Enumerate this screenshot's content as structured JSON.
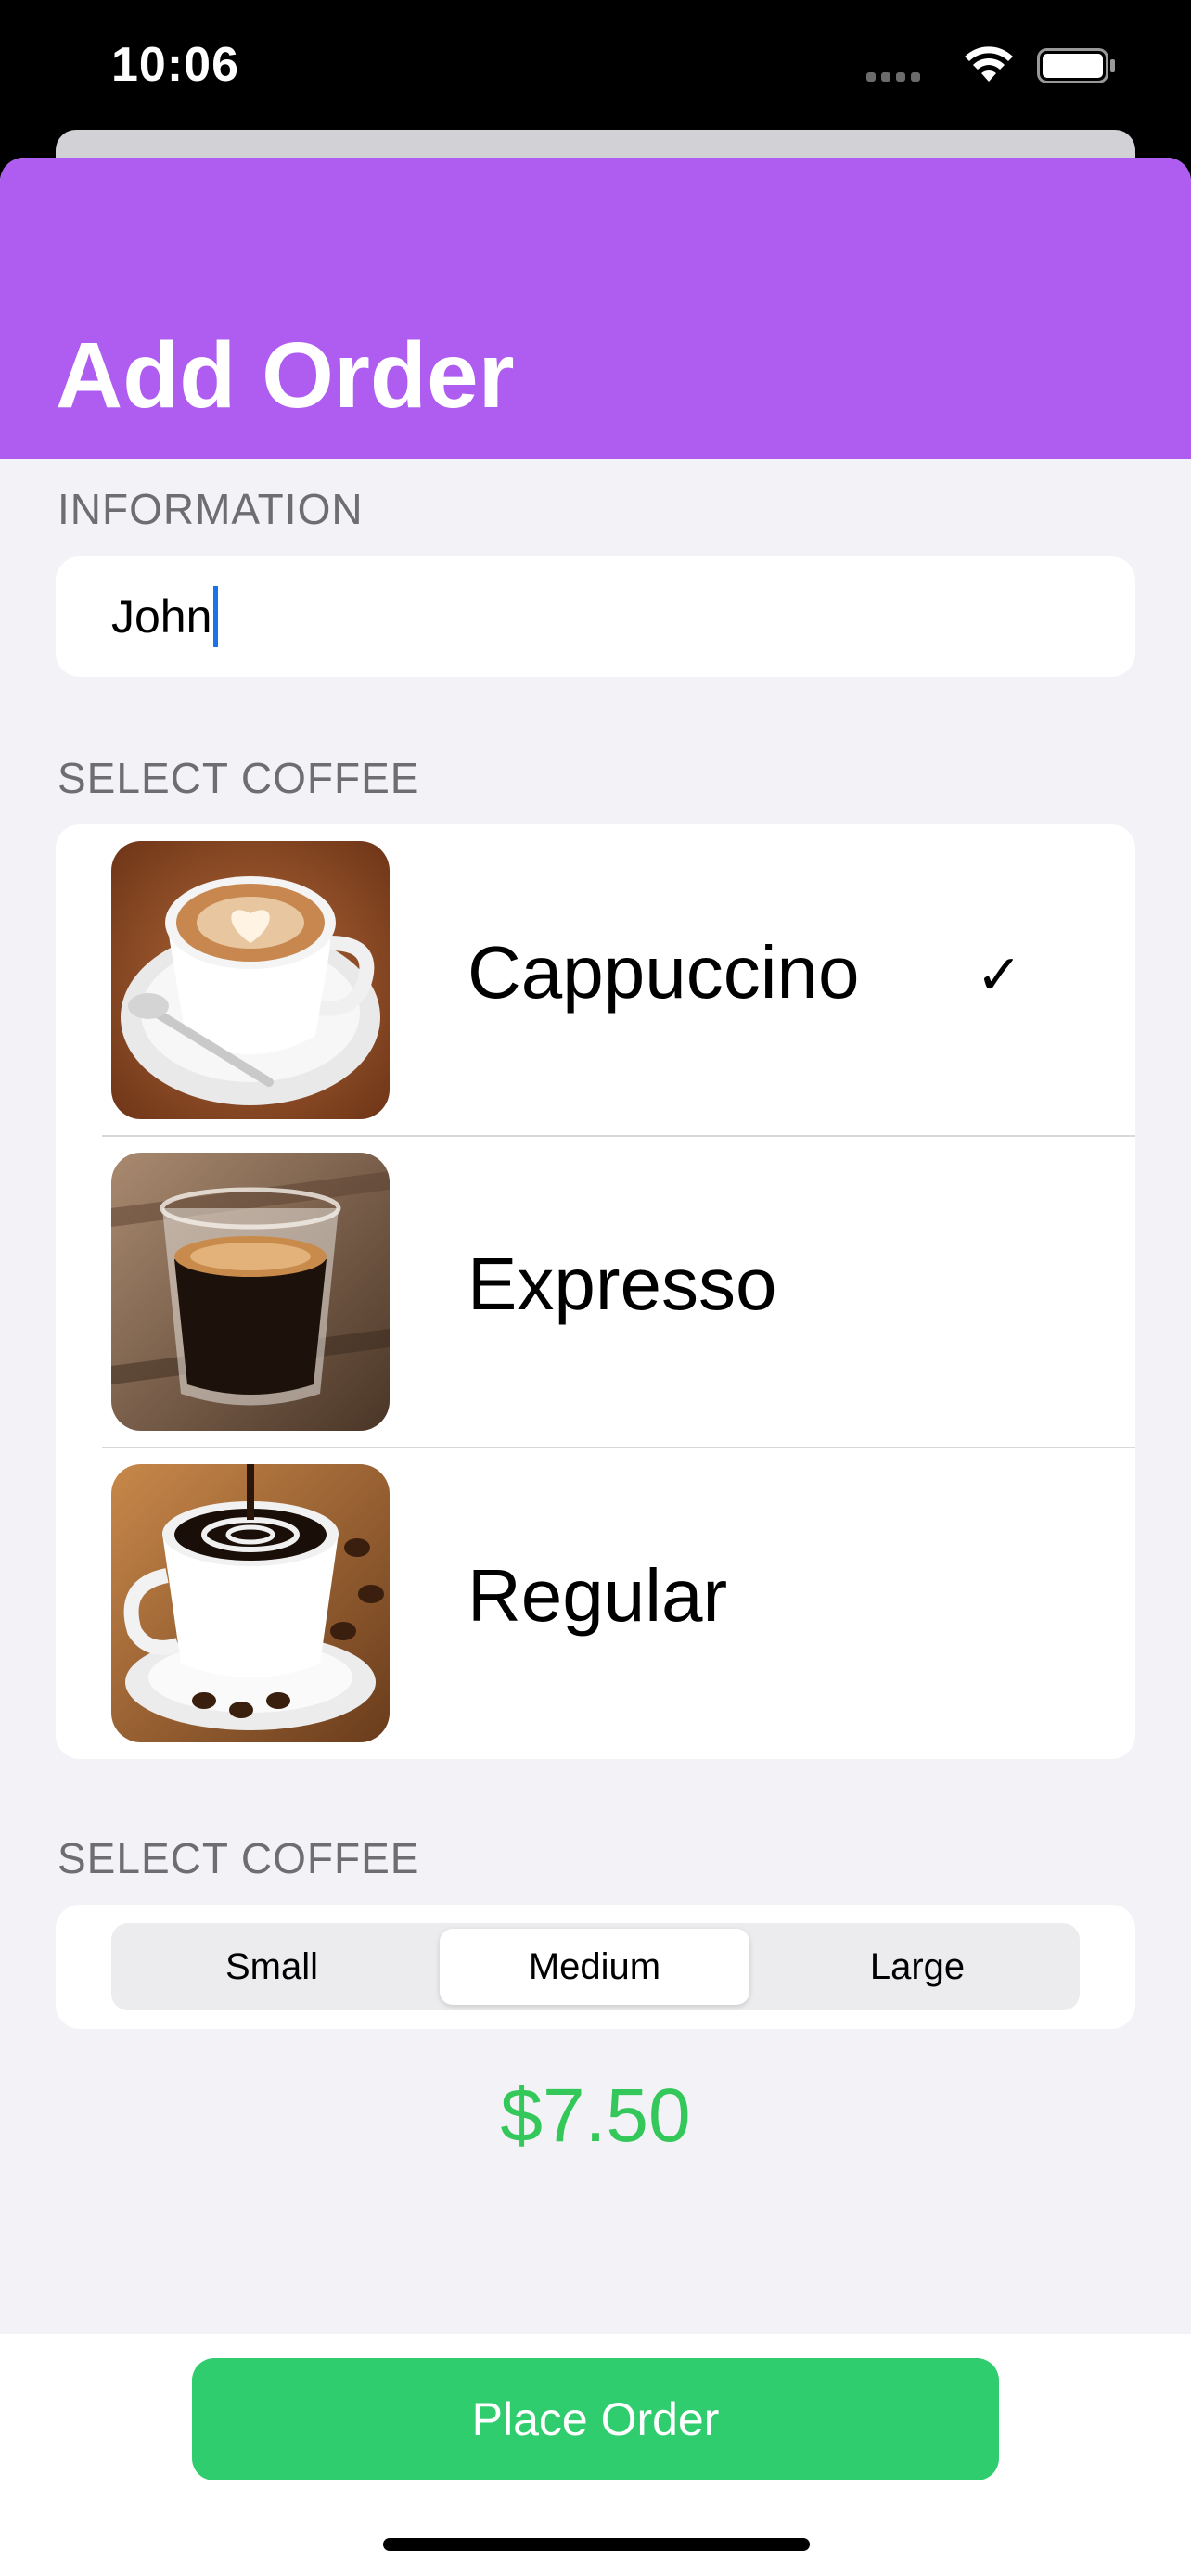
{
  "status_bar": {
    "time": "10:06"
  },
  "nav": {
    "title": "Add Order"
  },
  "information": {
    "section_label": "INFORMATION",
    "name_value": "John"
  },
  "coffee": {
    "section_label": "SELECT COFFEE",
    "items": [
      {
        "name": "Cappuccino",
        "selected": true,
        "image_icon": "cappuccino-photo"
      },
      {
        "name": "Expresso",
        "selected": false,
        "image_icon": "espresso-photo"
      },
      {
        "name": "Regular",
        "selected": false,
        "image_icon": "regular-coffee-photo"
      }
    ],
    "check_glyph": "✓"
  },
  "size": {
    "section_label": "SELECT COFFEE",
    "options": [
      "Small",
      "Medium",
      "Large"
    ],
    "selected": "Medium"
  },
  "price": "$7.50",
  "actions": {
    "place_order": "Place Order"
  },
  "colors": {
    "header_purple": "#af5cf1",
    "accent_green": "#34c759",
    "button_green": "#30cd6e",
    "background": "#f2f2f7"
  }
}
